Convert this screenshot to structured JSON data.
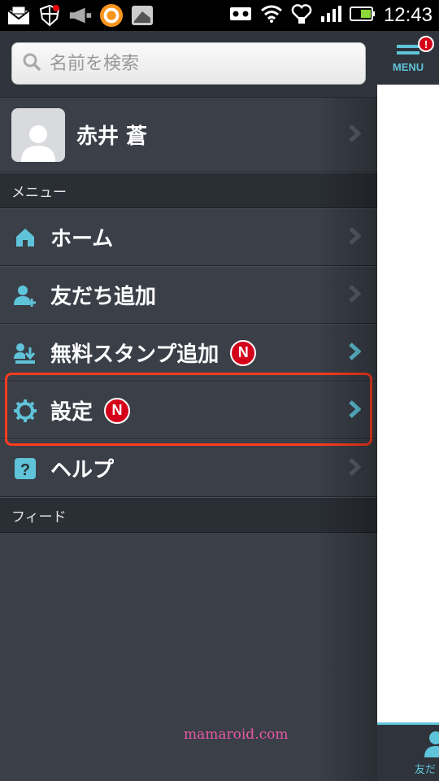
{
  "status_bar": {
    "time": "12:43",
    "icons": [
      "mail-icon",
      "shield-icon",
      "megaphone-icon",
      "app-icon",
      "photo-icon",
      "voicemail-icon",
      "wifi-icon",
      "heart-icon",
      "signal-icon",
      "battery-icon"
    ]
  },
  "search": {
    "placeholder": "名前を検索"
  },
  "profile": {
    "name": "赤井 蒼"
  },
  "sections": {
    "menu": "メニュー",
    "feed": "フィード"
  },
  "menu_items": [
    {
      "label": "ホーム",
      "icon": "home-icon",
      "badge": ""
    },
    {
      "label": "友だち追加",
      "icon": "add-friend-icon",
      "badge": ""
    },
    {
      "label": "無料スタンプ追加",
      "icon": "sticker-download-icon",
      "badge": "N"
    },
    {
      "label": "設定",
      "icon": "gear-icon",
      "badge": "N"
    },
    {
      "label": "ヘルプ",
      "icon": "help-icon",
      "badge": ""
    }
  ],
  "main": {
    "menu_button_label": "MENU",
    "alert_badge": "!",
    "friends_tab_label": "友だ"
  },
  "watermark": "mamaroid.com",
  "colors": {
    "accent": "#5fc4d9",
    "badge": "#d4001a",
    "highlight": "#ff3c1e",
    "drawer_bg": "#3a3f48"
  }
}
